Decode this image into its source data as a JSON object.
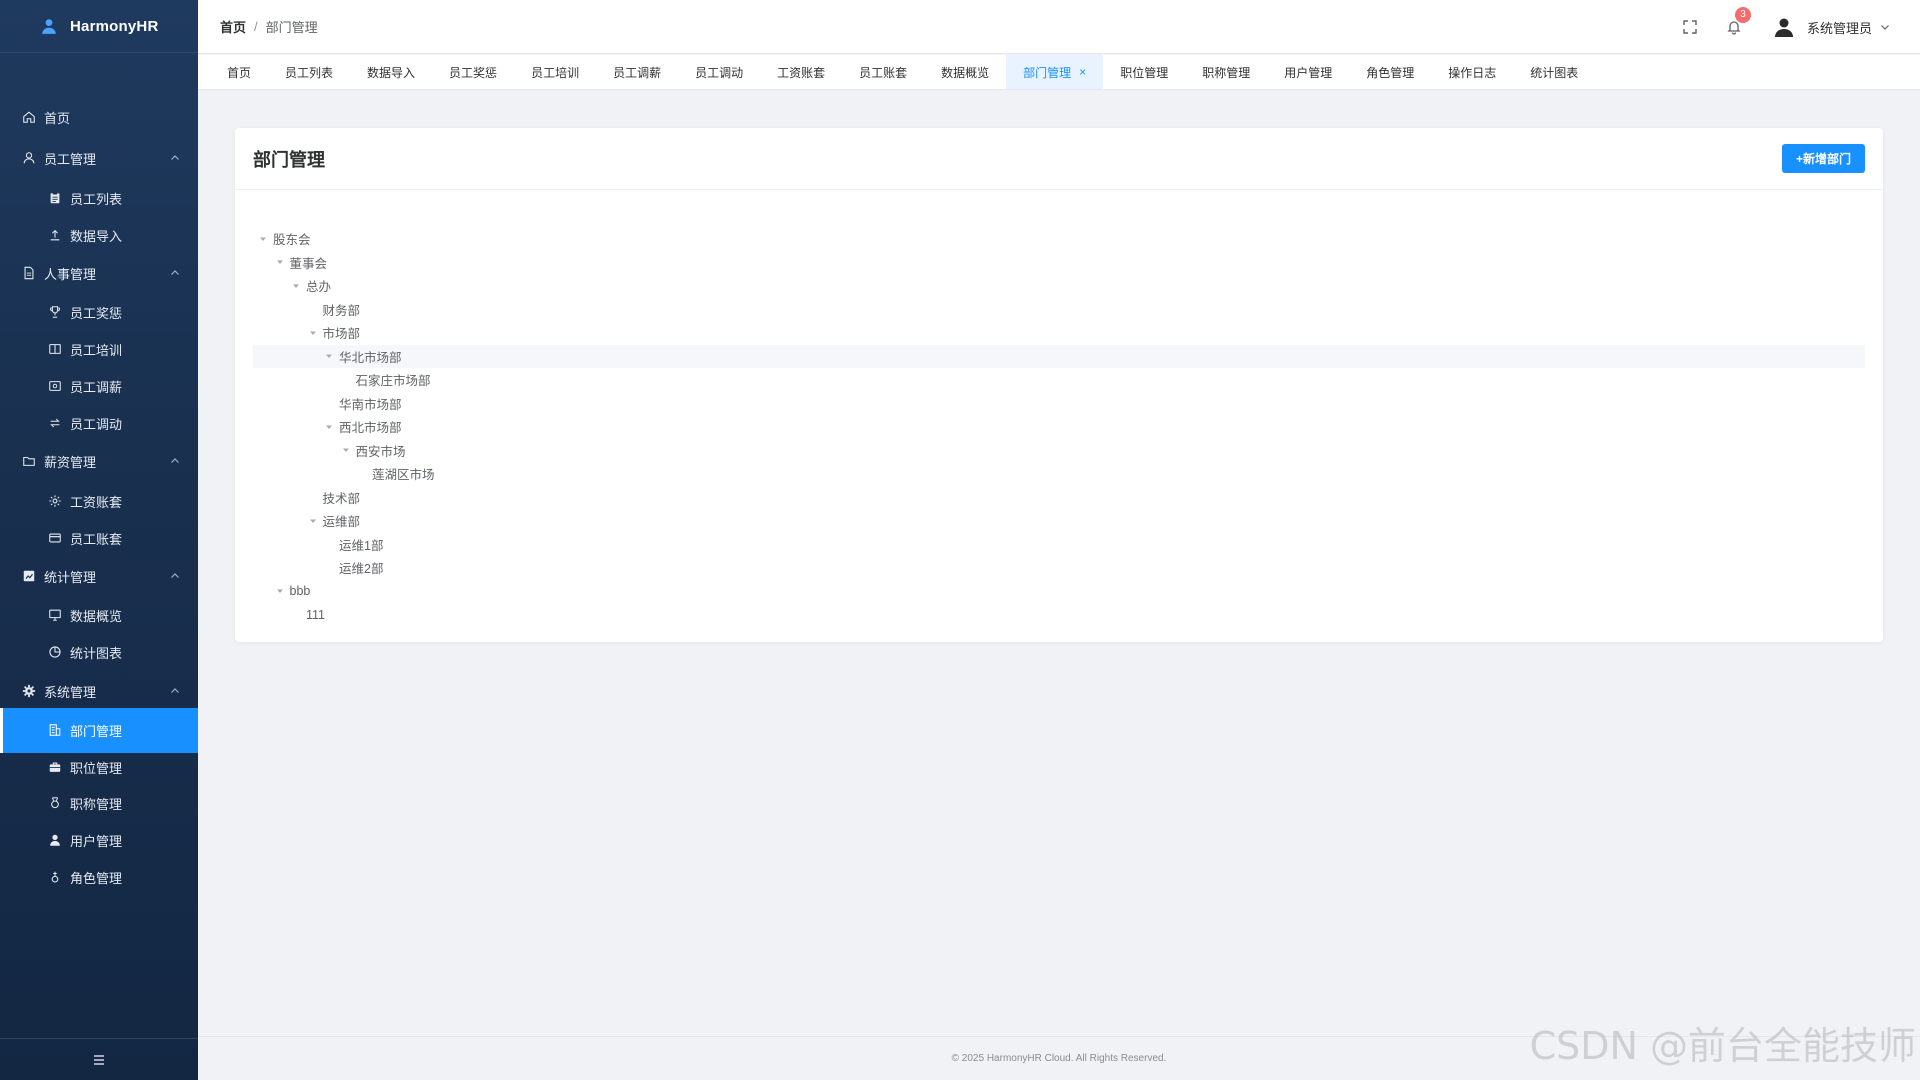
{
  "brand": {
    "name": "HarmonyHR",
    "icon": "user-icon"
  },
  "sidebar": {
    "items": [
      {
        "label": "首页",
        "icon": "home-icon",
        "type": "group"
      },
      {
        "label": "员工管理",
        "icon": "user-icon",
        "type": "group",
        "expanded": true
      },
      {
        "label": "员工列表",
        "icon": "clipboard-icon",
        "type": "sub"
      },
      {
        "label": "数据导入",
        "icon": "upload-icon",
        "type": "sub"
      },
      {
        "label": "人事管理",
        "icon": "document-icon",
        "type": "group",
        "expanded": true
      },
      {
        "label": "员工奖惩",
        "icon": "trophy-icon",
        "type": "sub"
      },
      {
        "label": "员工培训",
        "icon": "book-icon",
        "type": "sub"
      },
      {
        "label": "员工调薪",
        "icon": "money-icon",
        "type": "sub"
      },
      {
        "label": "员工调动",
        "icon": "switch-icon",
        "type": "sub"
      },
      {
        "label": "薪资管理",
        "icon": "folder-icon",
        "type": "group",
        "expanded": true
      },
      {
        "label": "工资账套",
        "icon": "gear-icon",
        "type": "sub"
      },
      {
        "label": "员工账套",
        "icon": "card-icon",
        "type": "sub"
      },
      {
        "label": "统计管理",
        "icon": "chart-icon",
        "type": "group",
        "expanded": true
      },
      {
        "label": "数据概览",
        "icon": "monitor-icon",
        "type": "sub"
      },
      {
        "label": "统计图表",
        "icon": "pie-icon",
        "type": "sub"
      },
      {
        "label": "系统管理",
        "icon": "settings-icon",
        "type": "group",
        "expanded": true
      },
      {
        "label": "部门管理",
        "icon": "building-icon",
        "type": "sub",
        "active": true
      },
      {
        "label": "职位管理",
        "icon": "briefcase-icon",
        "type": "sub"
      },
      {
        "label": "职称管理",
        "icon": "medal-icon",
        "type": "sub"
      },
      {
        "label": "用户管理",
        "icon": "person-icon",
        "type": "sub"
      },
      {
        "label": "角色管理",
        "icon": "role-icon",
        "type": "sub"
      }
    ],
    "footer_icon": "menu-fold-icon"
  },
  "header": {
    "breadcrumb_home": "首页",
    "breadcrumb_sep": "/",
    "breadcrumb_current": "部门管理",
    "notification_count": "3",
    "username": "系统管理员"
  },
  "tabs": [
    {
      "label": "首页"
    },
    {
      "label": "员工列表"
    },
    {
      "label": "数据导入"
    },
    {
      "label": "员工奖惩"
    },
    {
      "label": "员工培训"
    },
    {
      "label": "员工调薪"
    },
    {
      "label": "员工调动"
    },
    {
      "label": "工资账套"
    },
    {
      "label": "员工账套"
    },
    {
      "label": "数据概览"
    },
    {
      "label": "部门管理",
      "active": true,
      "closable": true
    },
    {
      "label": "职位管理"
    },
    {
      "label": "职称管理"
    },
    {
      "label": "用户管理"
    },
    {
      "label": "角色管理"
    },
    {
      "label": "操作日志"
    },
    {
      "label": "统计图表"
    }
  ],
  "card": {
    "title": "部门管理",
    "add_button": "+新增部门"
  },
  "tree": [
    {
      "label": "股东会",
      "level": 0,
      "expanded": true
    },
    {
      "label": "董事会",
      "level": 1,
      "expanded": true
    },
    {
      "label": "总办",
      "level": 2,
      "expanded": true
    },
    {
      "label": "财务部",
      "level": 3,
      "leaf": true
    },
    {
      "label": "市场部",
      "level": 3,
      "expanded": true
    },
    {
      "label": "华北市场部",
      "level": 4,
      "expanded": true,
      "hover": true
    },
    {
      "label": "石家庄市场部",
      "level": 5,
      "leaf": true
    },
    {
      "label": "华南市场部",
      "level": 4,
      "leaf": true
    },
    {
      "label": "西北市场部",
      "level": 4,
      "expanded": true
    },
    {
      "label": "西安市场",
      "level": 5,
      "expanded": true
    },
    {
      "label": "莲湖区市场",
      "level": 6,
      "leaf": true
    },
    {
      "label": "技术部",
      "level": 3,
      "leaf": true
    },
    {
      "label": "运维部",
      "level": 3,
      "expanded": true
    },
    {
      "label": "运维1部",
      "level": 4,
      "leaf": true
    },
    {
      "label": "运维2部",
      "level": 4,
      "leaf": true
    },
    {
      "label": "bbb",
      "level": 1,
      "expanded": true
    },
    {
      "label": "111",
      "level": 2,
      "leaf": true
    }
  ],
  "footer": {
    "copyright": "© 2025 HarmonyHR Cloud. All Rights Reserved."
  },
  "watermark": "CSDN @前台全能技师",
  "colors": {
    "accent": "#1890ff",
    "sidebar_bg": "#19304f",
    "badge": "#f56c6c"
  }
}
